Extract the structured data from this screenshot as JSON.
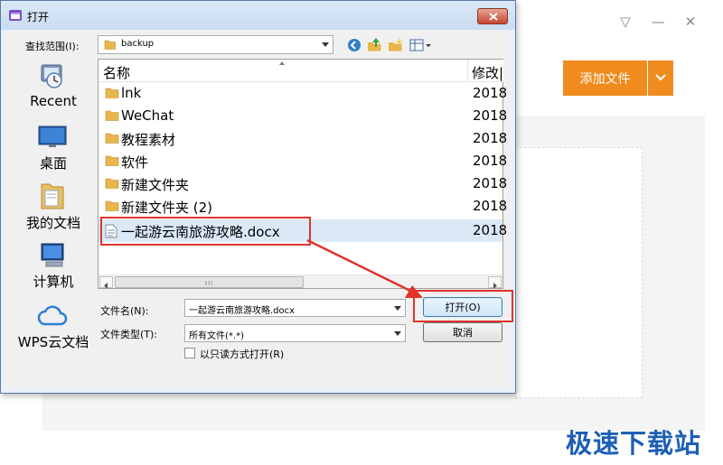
{
  "background_app": {
    "window_controls": [
      "▽",
      "—",
      "✕"
    ],
    "add_button_label": "添加文件",
    "accent": "#f08c1e"
  },
  "watermark": "极速下载站",
  "dialog": {
    "title": "打开",
    "look_in_label": "查找范围(I):",
    "look_in_value": "backup",
    "places": [
      {
        "label": "Recent",
        "icon": "recent-places-icon"
      },
      {
        "label": "桌面",
        "icon": "desktop-icon"
      },
      {
        "label": "我的文档",
        "icon": "documents-icon"
      },
      {
        "label": "计算机",
        "icon": "computer-icon"
      },
      {
        "label": "WPS云文档",
        "icon": "cloud-icon"
      }
    ],
    "columns": {
      "name": "名称",
      "date": "修改|"
    },
    "files": [
      {
        "name": "lnk",
        "date": "2018",
        "type": "folder"
      },
      {
        "name": "WeChat",
        "date": "2018",
        "type": "folder"
      },
      {
        "name": "教程素材",
        "date": "2018",
        "type": "folder"
      },
      {
        "name": "软件",
        "date": "2018",
        "type": "folder"
      },
      {
        "name": "新建文件夹",
        "date": "2018",
        "type": "folder"
      },
      {
        "name": "新建文件夹 (2)",
        "date": "2018",
        "type": "folder"
      },
      {
        "name": "一起游云南旅游攻略.docx",
        "date": "2018",
        "type": "document",
        "selected": true
      }
    ],
    "scroll_grip": "III",
    "filename_label": "文件名(N):",
    "filename_value": "一起游云南旅游攻略.docx",
    "filetype_label": "文件类型(T):",
    "filetype_value": "所有文件(*.*)",
    "readonly_label": "以只读方式打开(R)",
    "readonly_checked": false,
    "open_button": "打开(O)",
    "cancel_button": "取消",
    "annotation_color": "#e0332a"
  }
}
